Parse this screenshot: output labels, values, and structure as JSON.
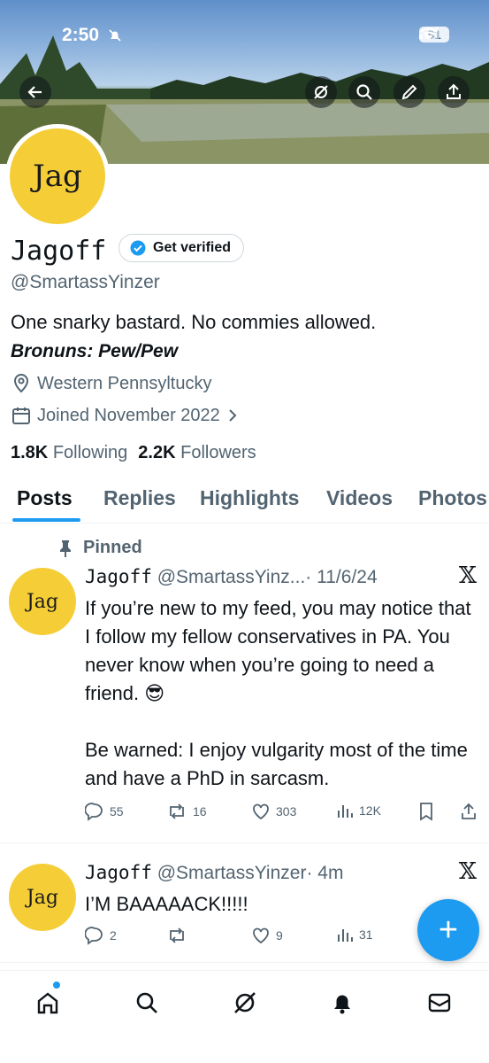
{
  "status_bar": {
    "time": "2:50",
    "battery": "81"
  },
  "profile": {
    "avatar_text": "Jag",
    "name": "Jagoff",
    "verify_label": "Get verified",
    "handle": "@SmartassYinzer",
    "bio": "One snarky bastard. No commies allowed.",
    "pronouns": "Bronuns: Pew/Pew",
    "location": "Western Pennsyltucky",
    "joined": "Joined November 2022",
    "following_count": "1.8K",
    "following_label": "Following",
    "followers_count": "2.2K",
    "followers_label": "Followers"
  },
  "tabs": [
    {
      "label": "Posts"
    },
    {
      "label": "Replies"
    },
    {
      "label": "Highlights"
    },
    {
      "label": "Videos"
    },
    {
      "label": "Photos"
    }
  ],
  "posts": [
    {
      "pinned_label": "Pinned",
      "avatar_text": "Jag",
      "name": "Jagoff",
      "handle": "@SmartassYinz...",
      "time": "· 11/6/24",
      "text": "If you’re new to my feed, you may notice that I follow my fellow conservatives in PA. You never know when you’re going to need a friend. 😎\n\nBe warned: I enjoy vulgarity most of the time and have a PhD in sarcasm.",
      "replies": "55",
      "reposts": "16",
      "likes": "303",
      "views": "12K"
    },
    {
      "avatar_text": "Jag",
      "name": "Jagoff",
      "handle": "@SmartassYinzer",
      "time": "· 4m",
      "text": "I’M BAAAAACK!!!!!",
      "replies": "2",
      "reposts": "",
      "likes": "9",
      "views": "31"
    }
  ],
  "fab": {
    "label": "+"
  },
  "colors": {
    "accent": "#1d9bf0",
    "avatar": "#f5ce37",
    "secondary_text": "#536471"
  }
}
